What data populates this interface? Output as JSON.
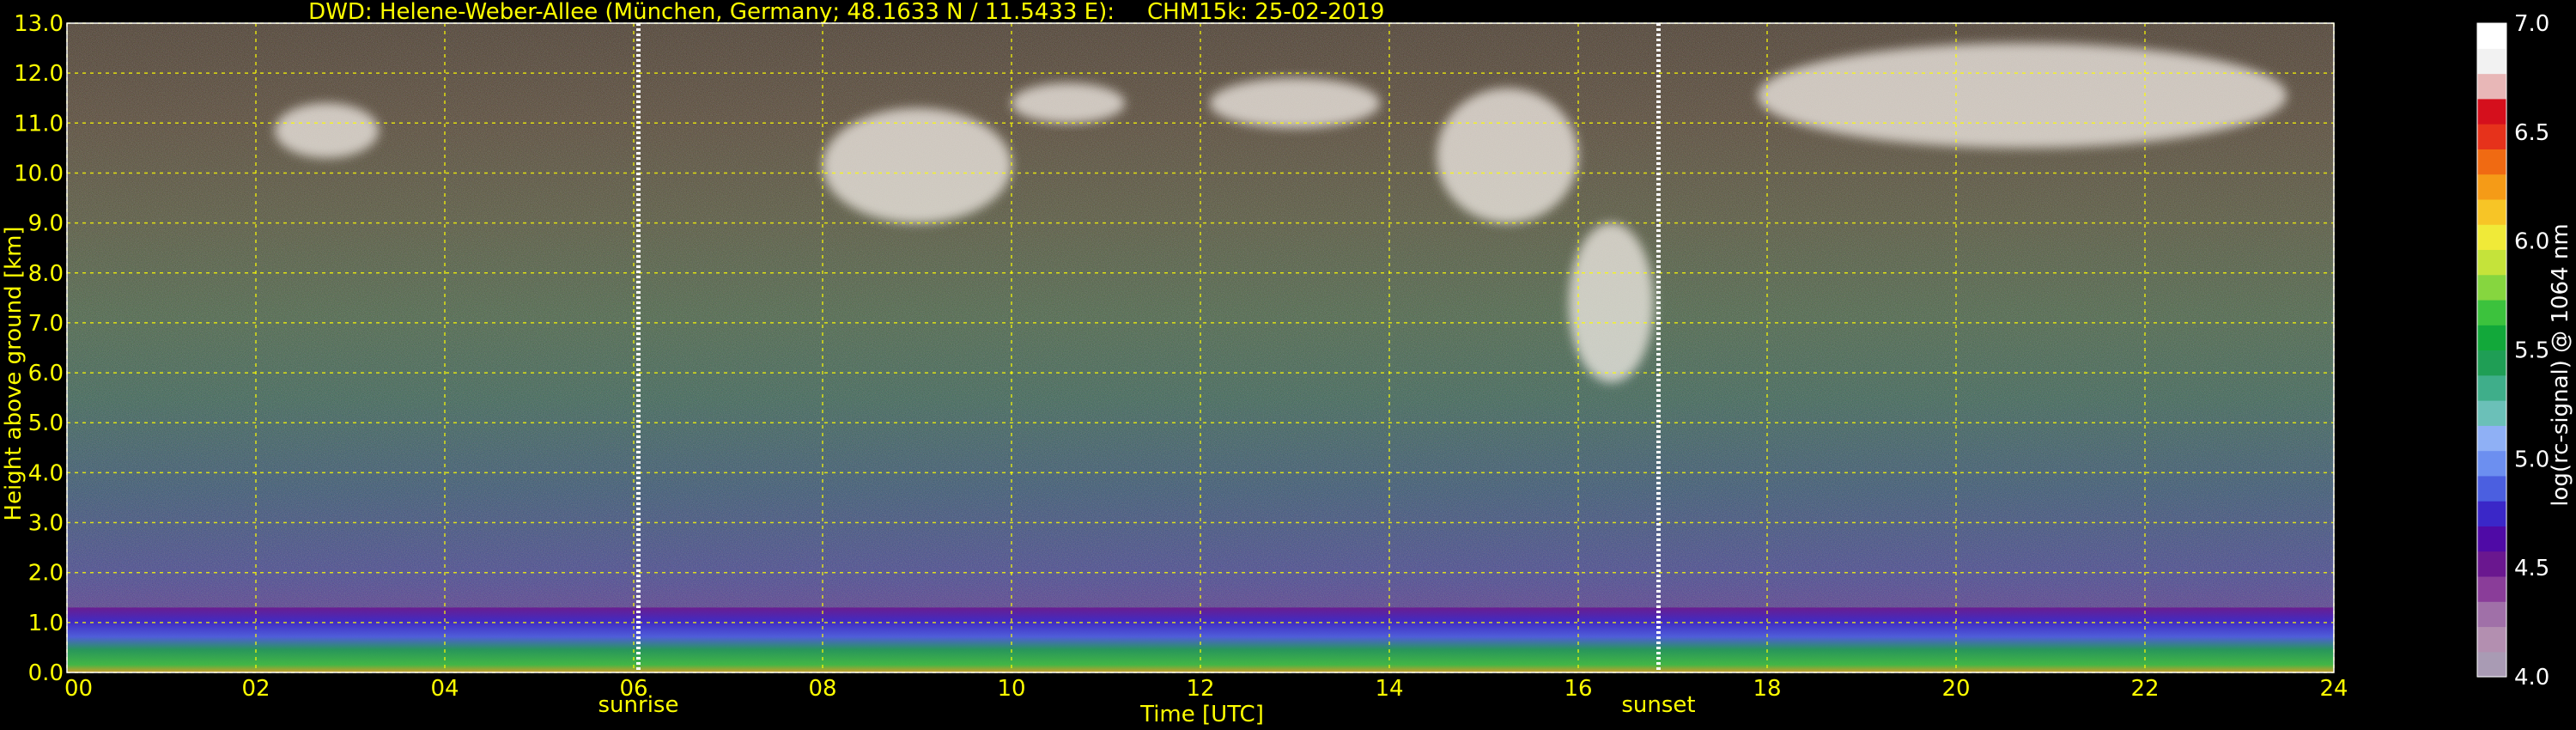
{
  "chart_data": {
    "type": "heatmap",
    "title": "DWD: Helene-Weber-Allee (München, Germany; 48.1633 N / 11.5433 E):",
    "subtitle": "CHM15k: 25-02-2019",
    "xlabel": "Time [UTC]",
    "ylabel": "Height above ground [km]",
    "xlim": [
      0,
      24
    ],
    "ylim": [
      0,
      13
    ],
    "x_ticks": [
      "00",
      "02",
      "04",
      "06",
      "08",
      "10",
      "12",
      "14",
      "16",
      "18",
      "20",
      "22",
      "24"
    ],
    "y_ticks": [
      "0.0",
      "1.0",
      "2.0",
      "3.0",
      "4.0",
      "5.0",
      "6.0",
      "7.0",
      "8.0",
      "9.0",
      "10.0",
      "11.0",
      "12.0",
      "13.0"
    ],
    "grid": true,
    "annotations": [
      {
        "label": "sunrise",
        "time": 6.05
      },
      {
        "label": "sunset",
        "time": 16.85
      }
    ],
    "colorbar": {
      "label": "log(rc-signal) @ 1064 nm",
      "min": 4.0,
      "max": 7.0,
      "ticks": [
        "4.0",
        "4.5",
        "5.0",
        "5.5",
        "6.0",
        "6.5",
        "7.0"
      ],
      "colors": [
        "#a99bb4",
        "#b38fb0",
        "#a070a8",
        "#8a3d99",
        "#6a178f",
        "#4f0aa6",
        "#3a27c8",
        "#4b5fe0",
        "#6c8ff0",
        "#8fb0f5",
        "#6bc0b8",
        "#3fae8a",
        "#1f9e55",
        "#12a83a",
        "#3cc23d",
        "#86d63f",
        "#c5e33a",
        "#f0ea38",
        "#f7c526",
        "#f59b17",
        "#f06a12",
        "#e6321b",
        "#d50f1c",
        "#e8b7b7",
        "#f2f2f2",
        "#ffffff"
      ]
    },
    "features": [
      {
        "kind": "boundary_layer",
        "time_start": 0,
        "time_end": 24,
        "top_km": 1.3
      },
      {
        "kind": "cirrus",
        "time_start": 2.2,
        "time_end": 3.3,
        "base_km": 10.3,
        "top_km": 11.4
      },
      {
        "kind": "cirrus",
        "time_start": 8.0,
        "time_end": 10.0,
        "base_km": 9.0,
        "top_km": 11.3
      },
      {
        "kind": "cirrus",
        "time_start": 10.0,
        "time_end": 11.2,
        "base_km": 11.0,
        "top_km": 11.8
      },
      {
        "kind": "cirrus",
        "time_start": 12.1,
        "time_end": 13.9,
        "base_km": 10.9,
        "top_km": 11.9
      },
      {
        "kind": "cirrus",
        "time_start": 14.5,
        "time_end": 16.0,
        "base_km": 9.0,
        "top_km": 11.7
      },
      {
        "kind": "fall_streak",
        "time_start": 15.9,
        "time_end": 16.8,
        "base_km": 5.8,
        "top_km": 9.0
      },
      {
        "kind": "cirrus",
        "time_start": 17.9,
        "time_end": 23.5,
        "base_km": 10.5,
        "top_km": 12.6
      }
    ]
  }
}
